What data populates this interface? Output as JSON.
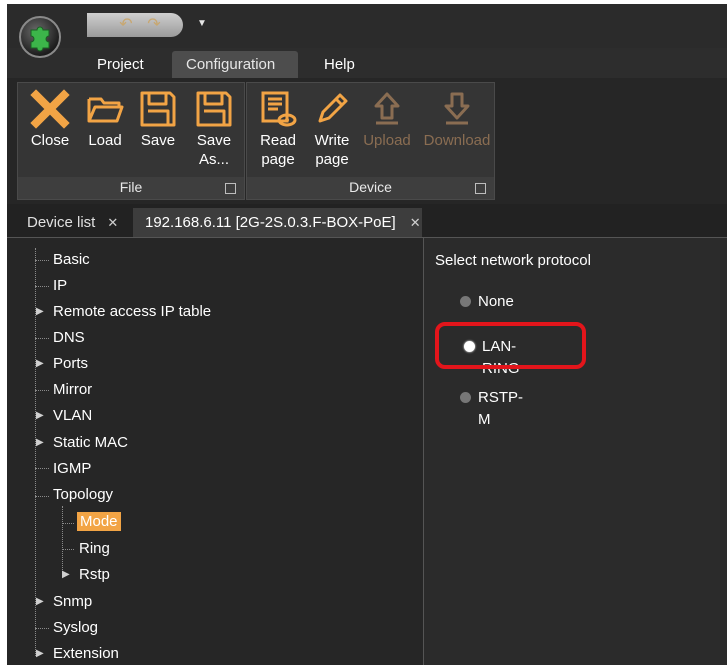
{
  "quick_access": {
    "undo_icon": "undo-arrow-icon",
    "redo_icon": "redo-arrow-icon",
    "dropdown_icon": "qat-dropdown-icon"
  },
  "menu_tabs": [
    {
      "label": "Project"
    },
    {
      "label": "Configuration"
    },
    {
      "label": "Help"
    }
  ],
  "ribbon": {
    "file_group": {
      "label": "File",
      "buttons": [
        {
          "line1": "Close",
          "line2": "",
          "icon": "close-x-icon"
        },
        {
          "line1": "Load",
          "line2": "",
          "icon": "folder-open-icon"
        },
        {
          "line1": "Save",
          "line2": "",
          "icon": "floppy-disk-icon"
        },
        {
          "line1": "Save",
          "line2": "As...",
          "icon": "floppy-disk-saveas-icon"
        }
      ]
    },
    "device_group": {
      "label": "Device",
      "buttons": [
        {
          "line1": "Read",
          "line2": "page",
          "icon": "read-page-icon"
        },
        {
          "line1": "Write",
          "line2": "page",
          "icon": "write-pencil-icon"
        },
        {
          "line1": "Upload",
          "line2": "",
          "icon": "upload-arrow-icon",
          "disabled": true
        },
        {
          "line1": "Download",
          "line2": "",
          "icon": "download-arrow-icon",
          "disabled": true
        }
      ]
    }
  },
  "doc_tabs": [
    {
      "label": "Device list"
    },
    {
      "label": "192.168.6.11 [2G-2S.0.3.F-BOX-PoE]"
    }
  ],
  "tree": [
    {
      "label": "Basic"
    },
    {
      "label": "IP"
    },
    {
      "label": "Remote access IP table"
    },
    {
      "label": "DNS"
    },
    {
      "label": "Ports"
    },
    {
      "label": "Mirror"
    },
    {
      "label": "VLAN"
    },
    {
      "label": "Static MAC"
    },
    {
      "label": "IGMP"
    },
    {
      "label": "Topology"
    },
    {
      "label": "Mode"
    },
    {
      "label": "Ring"
    },
    {
      "label": "Rstp"
    },
    {
      "label": "Snmp"
    },
    {
      "label": "Syslog"
    },
    {
      "label": "Extension"
    }
  ],
  "panel": {
    "heading": "Select network protocol",
    "options": [
      {
        "label": "None",
        "selected": false
      },
      {
        "label": "LAN-RING",
        "selected": true
      },
      {
        "label": "RSTP-M",
        "selected": false
      }
    ]
  },
  "colors": {
    "accent": "#f2a445",
    "highlight_border": "#e3151b",
    "disabled_text": "#8a6d52"
  }
}
